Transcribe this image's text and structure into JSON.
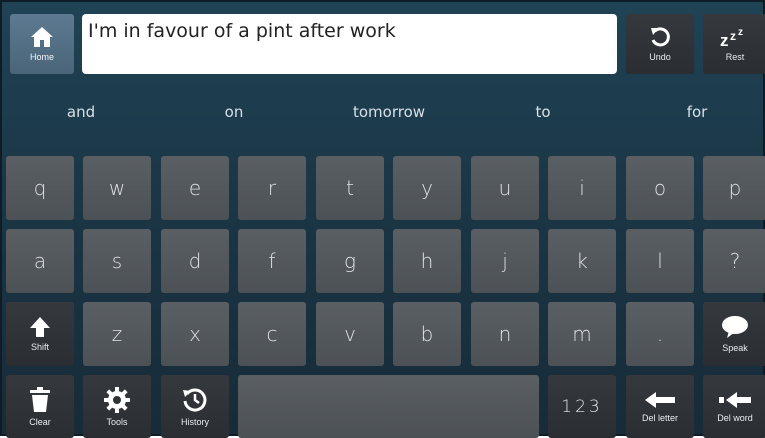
{
  "text_box": {
    "value": "I'm in favour of a pint after work"
  },
  "top_bar": {
    "home_label": "Home",
    "undo_label": "Undo",
    "rest_label": "Rest"
  },
  "predictions": [
    "and",
    "on",
    "tomorrow",
    "to",
    "for"
  ],
  "keyboard": {
    "row1": [
      "q",
      "w",
      "e",
      "r",
      "t",
      "y",
      "u",
      "i",
      "o",
      "p"
    ],
    "row2": [
      "a",
      "s",
      "d",
      "f",
      "g",
      "h",
      "j",
      "k",
      "l",
      "?"
    ],
    "row3": [
      "z",
      "x",
      "c",
      "v",
      "b",
      "n",
      "m",
      "."
    ],
    "shift_label": "Shift",
    "speak_label": "Speak",
    "clear_label": "Clear",
    "tools_label": "Tools",
    "history_label": "History",
    "numbers_label": "123",
    "del_letter_label": "Del letter",
    "del_word_label": "Del word"
  },
  "icons": {
    "home": "home-icon",
    "undo": "undo-icon",
    "rest": "zzz-icon",
    "shift": "shift-arrow-icon",
    "speak": "speech-bubble-icon",
    "clear": "trash-icon",
    "tools": "gear-icon",
    "history": "history-clock-icon",
    "del_letter": "left-arrow-icon",
    "del_word": "arrow-to-bar-icon"
  },
  "colors": {
    "background": "#1b3646",
    "letter_key": "#53585d",
    "function_key": "#303437",
    "home_key": "#54708a",
    "text_box": "#ffffff"
  }
}
